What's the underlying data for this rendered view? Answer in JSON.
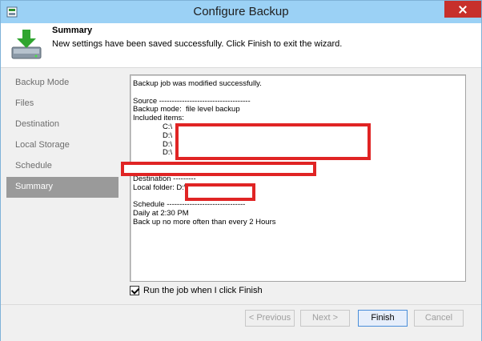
{
  "window": {
    "title": "Configure Backup"
  },
  "header": {
    "title": "Summary",
    "subtitle": "New settings have been saved successfully. Click Finish to exit the wizard."
  },
  "nav": {
    "items": [
      {
        "label": "Backup Mode",
        "active": false
      },
      {
        "label": "Files",
        "active": false
      },
      {
        "label": "Destination",
        "active": false
      },
      {
        "label": "Local Storage",
        "active": false
      },
      {
        "label": "Schedule",
        "active": false
      },
      {
        "label": "Summary",
        "active": true
      }
    ]
  },
  "summary": {
    "text": "Backup job was modified successfully.\n\nSource ------------------------------------\nBackup mode:  file level backup\nIncluded items:\n              C:\\\n              D:\\\n              D:\\\n              D:\\\n\n\nDestination ---------\nLocal folder: D:\\\n\nSchedule -------------------------------\nDaily at 2:30 PM\nBack up no more often than every 2 Hours"
  },
  "options": {
    "run_on_finish_label": "Run the job when I click Finish",
    "run_on_finish_checked": true
  },
  "buttons": {
    "previous": "< Previous",
    "next": "Next >",
    "finish": "Finish",
    "cancel": "Cancel"
  },
  "colors": {
    "titlebar": "#9bd1f5",
    "close": "#c7302b",
    "nav_active": "#9a9a9a",
    "redaction": "#e02424",
    "primary_border": "#4a8ed9"
  }
}
